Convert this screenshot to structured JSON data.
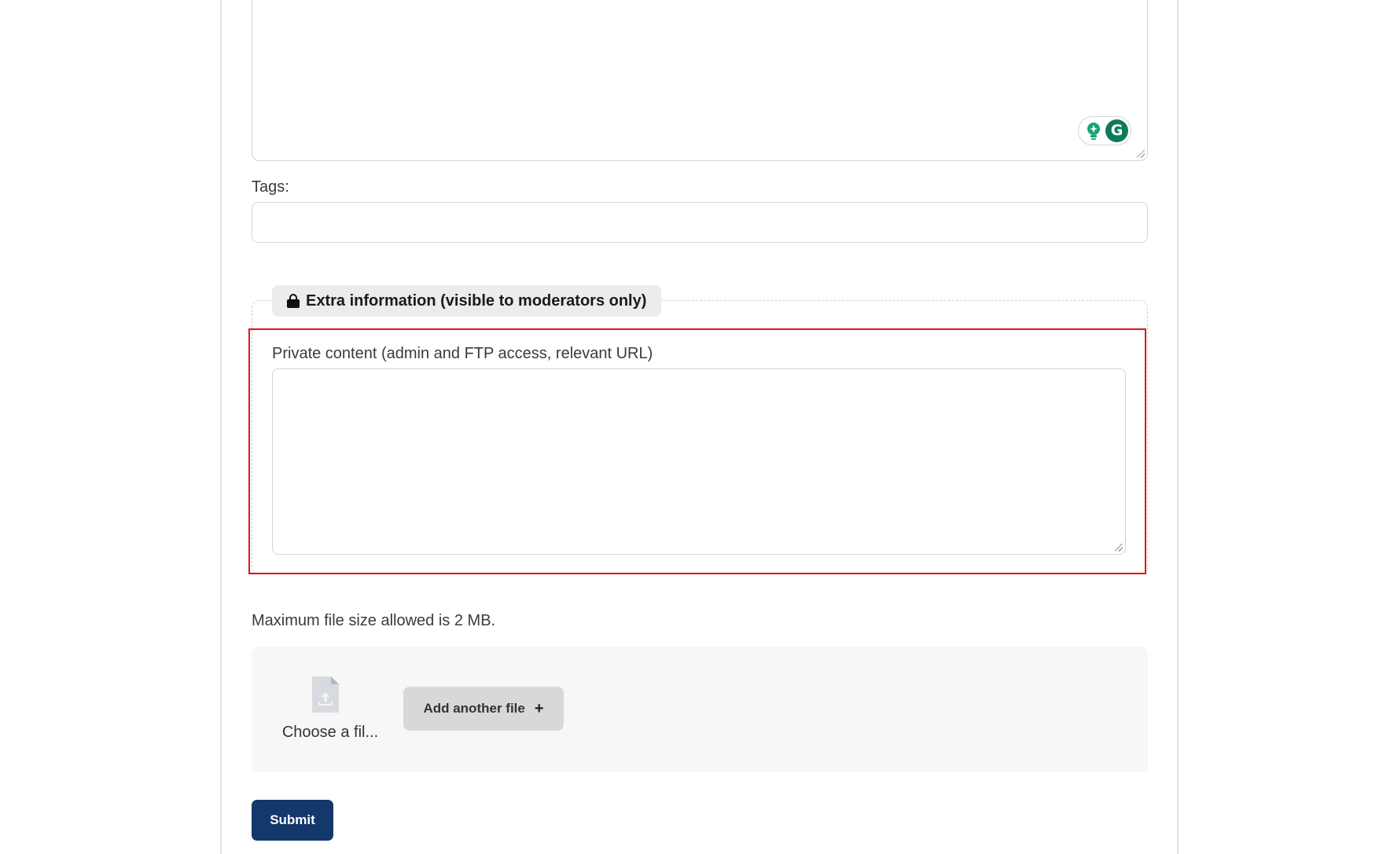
{
  "form": {
    "grammarly_logo_letter": "G",
    "tags_label": "Tags:",
    "extra_info": {
      "legend": "Extra information (visible to moderators only)",
      "icon": "lock-icon",
      "private_label": "Private content (admin and FTP access, relevant URL)"
    },
    "max_file_note": "Maximum file size allowed is 2 MB.",
    "upload": {
      "file_name": "Choose a fil...",
      "file_icon": "file-upload-icon",
      "add_file_label": "Add another file",
      "add_icon": "plus-icon"
    },
    "submit_label": "Submit"
  },
  "colors": {
    "primary": "#14386a",
    "highlight": "#e01414",
    "grammarly": "#0f7a5b"
  }
}
